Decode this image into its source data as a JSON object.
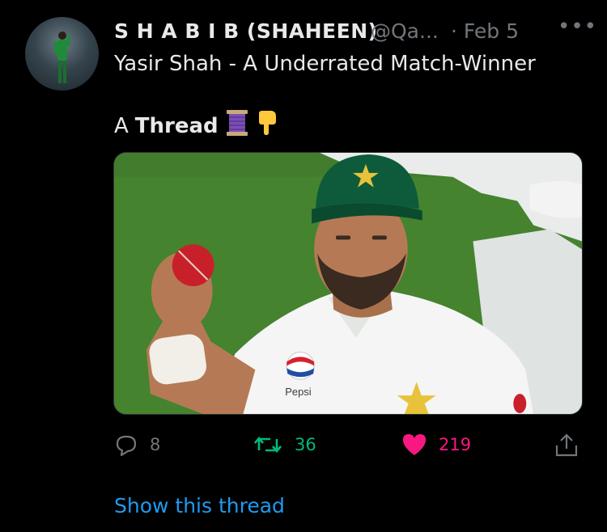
{
  "tweet": {
    "author_name": "S H A B I B (SHAHEEN)",
    "author_handle": "@Qa...",
    "date": "· Feb 5",
    "more_icon": "more-icon",
    "text_line1": "Yasir Shah - A Underrated Match-Winner",
    "text_line2_prefix": "A",
    "text_line2_bold": "Thread",
    "emojis": [
      "thread-spool-emoji",
      "pointing-down-emoji"
    ],
    "media": {
      "description_icon": "cricket-player-photo",
      "cap_logo_text": "",
      "shirt_text": "Pepsi"
    },
    "actions": {
      "reply_count": "8",
      "retweet_count": "36",
      "like_count": "219"
    },
    "show_thread": "Show this thread"
  },
  "colors": {
    "background": "#000000",
    "muted": "#71767b",
    "retweet": "#00ba7c",
    "like": "#f91880",
    "link": "#1d9bf0"
  }
}
